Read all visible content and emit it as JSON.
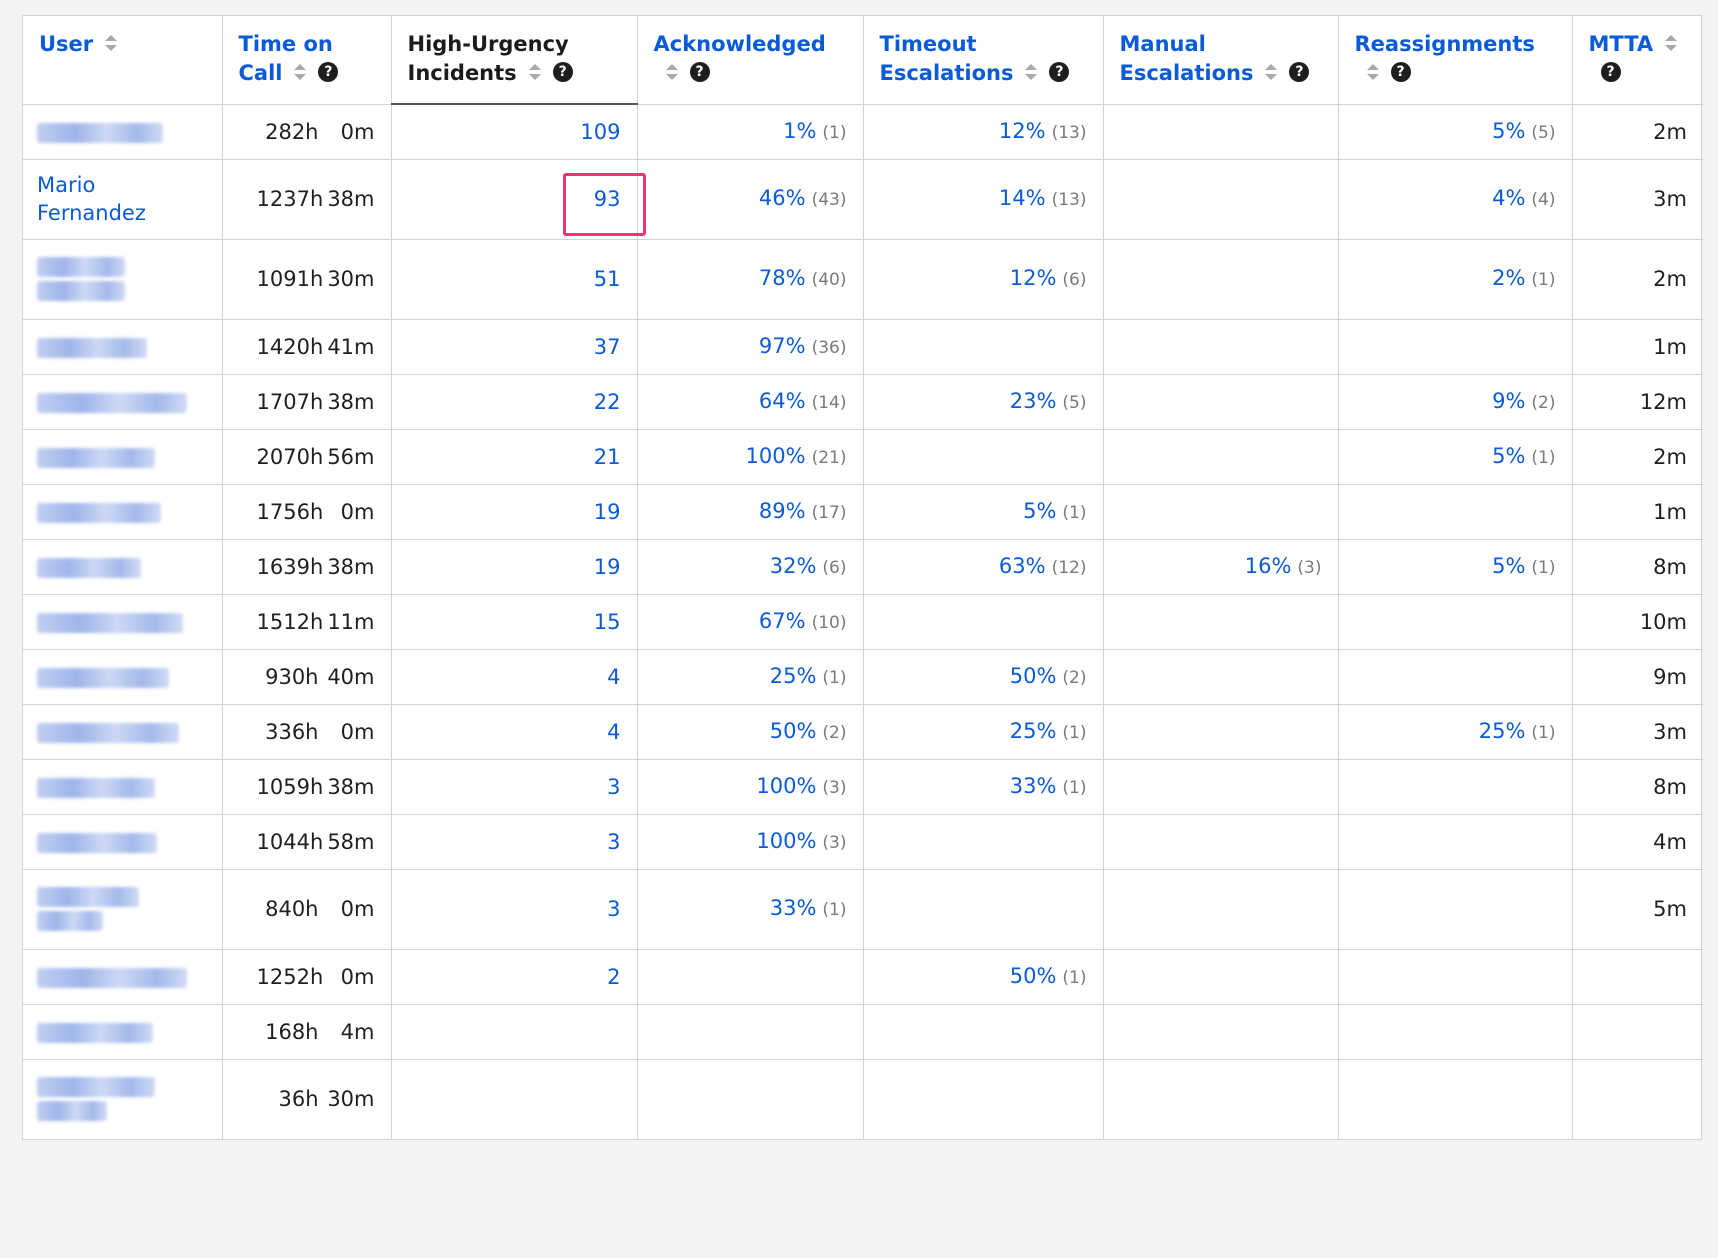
{
  "columns": [
    {
      "label": "User",
      "sortable": true,
      "help": false
    },
    {
      "label": "Time on Call",
      "sortable": true,
      "help": true
    },
    {
      "label": "High-Urgency Incidents",
      "sortable": true,
      "help": true,
      "sorted": true
    },
    {
      "label": "Acknowledged",
      "sortable": true,
      "help": true
    },
    {
      "label": "Timeout Escalations",
      "sortable": true,
      "help": true
    },
    {
      "label": "Manual Escalations",
      "sortable": true,
      "help": true
    },
    {
      "label": "Reassignments",
      "sortable": true,
      "help": true
    },
    {
      "label": "MTTA",
      "sortable": true,
      "help": true
    }
  ],
  "help_glyph": "?",
  "highlighted_cell": {
    "row": 1,
    "column": "High-Urgency Incidents"
  },
  "rows": [
    {
      "user": "",
      "user_blurred": true,
      "hours": "282h",
      "minutes": "0m",
      "incidents": "109",
      "ack_pct": "1%",
      "ack_count": "(1)",
      "timeout_pct": "12%",
      "timeout_count": "(13)",
      "manual_pct": "",
      "manual_count": "",
      "reassign_pct": "5%",
      "reassign_count": "(5)",
      "mtta": "2m"
    },
    {
      "user": "Mario Fernandez",
      "user_blurred": false,
      "hours": "1237h",
      "minutes": "38m",
      "incidents": "93",
      "ack_pct": "46%",
      "ack_count": "(43)",
      "timeout_pct": "14%",
      "timeout_count": "(13)",
      "manual_pct": "",
      "manual_count": "",
      "reassign_pct": "4%",
      "reassign_count": "(4)",
      "mtta": "3m"
    },
    {
      "user": "",
      "user_blurred": true,
      "hours": "1091h",
      "minutes": "30m",
      "incidents": "51",
      "ack_pct": "78%",
      "ack_count": "(40)",
      "timeout_pct": "12%",
      "timeout_count": "(6)",
      "manual_pct": "",
      "manual_count": "",
      "reassign_pct": "2%",
      "reassign_count": "(1)",
      "mtta": "2m"
    },
    {
      "user": "",
      "user_blurred": true,
      "hours": "1420h",
      "minutes": "41m",
      "incidents": "37",
      "ack_pct": "97%",
      "ack_count": "(36)",
      "timeout_pct": "",
      "timeout_count": "",
      "manual_pct": "",
      "manual_count": "",
      "reassign_pct": "",
      "reassign_count": "",
      "mtta": "1m"
    },
    {
      "user": "",
      "user_blurred": true,
      "hours": "1707h",
      "minutes": "38m",
      "incidents": "22",
      "ack_pct": "64%",
      "ack_count": "(14)",
      "timeout_pct": "23%",
      "timeout_count": "(5)",
      "manual_pct": "",
      "manual_count": "",
      "reassign_pct": "9%",
      "reassign_count": "(2)",
      "mtta": "12m"
    },
    {
      "user": "",
      "user_blurred": true,
      "hours": "2070h",
      "minutes": "56m",
      "incidents": "21",
      "ack_pct": "100%",
      "ack_count": "(21)",
      "timeout_pct": "",
      "timeout_count": "",
      "manual_pct": "",
      "manual_count": "",
      "reassign_pct": "5%",
      "reassign_count": "(1)",
      "mtta": "2m"
    },
    {
      "user": "",
      "user_blurred": true,
      "hours": "1756h",
      "minutes": "0m",
      "incidents": "19",
      "ack_pct": "89%",
      "ack_count": "(17)",
      "timeout_pct": "5%",
      "timeout_count": "(1)",
      "manual_pct": "",
      "manual_count": "",
      "reassign_pct": "",
      "reassign_count": "",
      "mtta": "1m"
    },
    {
      "user": "",
      "user_blurred": true,
      "hours": "1639h",
      "minutes": "38m",
      "incidents": "19",
      "ack_pct": "32%",
      "ack_count": "(6)",
      "timeout_pct": "63%",
      "timeout_count": "(12)",
      "manual_pct": "16%",
      "manual_count": "(3)",
      "reassign_pct": "5%",
      "reassign_count": "(1)",
      "mtta": "8m"
    },
    {
      "user": "",
      "user_blurred": true,
      "hours": "1512h",
      "minutes": "11m",
      "incidents": "15",
      "ack_pct": "67%",
      "ack_count": "(10)",
      "timeout_pct": "",
      "timeout_count": "",
      "manual_pct": "",
      "manual_count": "",
      "reassign_pct": "",
      "reassign_count": "",
      "mtta": "10m"
    },
    {
      "user": "",
      "user_blurred": true,
      "hours": "930h",
      "minutes": "40m",
      "incidents": "4",
      "ack_pct": "25%",
      "ack_count": "(1)",
      "timeout_pct": "50%",
      "timeout_count": "(2)",
      "manual_pct": "",
      "manual_count": "",
      "reassign_pct": "",
      "reassign_count": "",
      "mtta": "9m"
    },
    {
      "user": "",
      "user_blurred": true,
      "hours": "336h",
      "minutes": "0m",
      "incidents": "4",
      "ack_pct": "50%",
      "ack_count": "(2)",
      "timeout_pct": "25%",
      "timeout_count": "(1)",
      "manual_pct": "",
      "manual_count": "",
      "reassign_pct": "25%",
      "reassign_count": "(1)",
      "mtta": "3m"
    },
    {
      "user": "",
      "user_blurred": true,
      "hours": "1059h",
      "minutes": "38m",
      "incidents": "3",
      "ack_pct": "100%",
      "ack_count": "(3)",
      "timeout_pct": "33%",
      "timeout_count": "(1)",
      "manual_pct": "",
      "manual_count": "",
      "reassign_pct": "",
      "reassign_count": "",
      "mtta": "8m"
    },
    {
      "user": "",
      "user_blurred": true,
      "hours": "1044h",
      "minutes": "58m",
      "incidents": "3",
      "ack_pct": "100%",
      "ack_count": "(3)",
      "timeout_pct": "",
      "timeout_count": "",
      "manual_pct": "",
      "manual_count": "",
      "reassign_pct": "",
      "reassign_count": "",
      "mtta": "4m"
    },
    {
      "user": "",
      "user_blurred": true,
      "hours": "840h",
      "minutes": "0m",
      "incidents": "3",
      "ack_pct": "33%",
      "ack_count": "(1)",
      "timeout_pct": "",
      "timeout_count": "",
      "manual_pct": "",
      "manual_count": "",
      "reassign_pct": "",
      "reassign_count": "",
      "mtta": "5m"
    },
    {
      "user": "",
      "user_blurred": true,
      "hours": "1252h",
      "minutes": "0m",
      "incidents": "2",
      "ack_pct": "",
      "ack_count": "",
      "timeout_pct": "50%",
      "timeout_count": "(1)",
      "manual_pct": "",
      "manual_count": "",
      "reassign_pct": "",
      "reassign_count": "",
      "mtta": ""
    },
    {
      "user": "",
      "user_blurred": true,
      "hours": "168h",
      "minutes": "4m",
      "incidents": "",
      "ack_pct": "",
      "ack_count": "",
      "timeout_pct": "",
      "timeout_count": "",
      "manual_pct": "",
      "manual_count": "",
      "reassign_pct": "",
      "reassign_count": "",
      "mtta": ""
    },
    {
      "user": "",
      "user_blurred": true,
      "hours": "36h",
      "minutes": "30m",
      "incidents": "",
      "ack_pct": "",
      "ack_count": "",
      "timeout_pct": "",
      "timeout_count": "",
      "manual_pct": "",
      "manual_count": "",
      "reassign_pct": "",
      "reassign_count": "",
      "mtta": ""
    }
  ],
  "colors": {
    "link": "#0b5bd6",
    "highlight": "#ee3377",
    "muted": "#7a7a7a",
    "border": "#d4d4d4"
  }
}
